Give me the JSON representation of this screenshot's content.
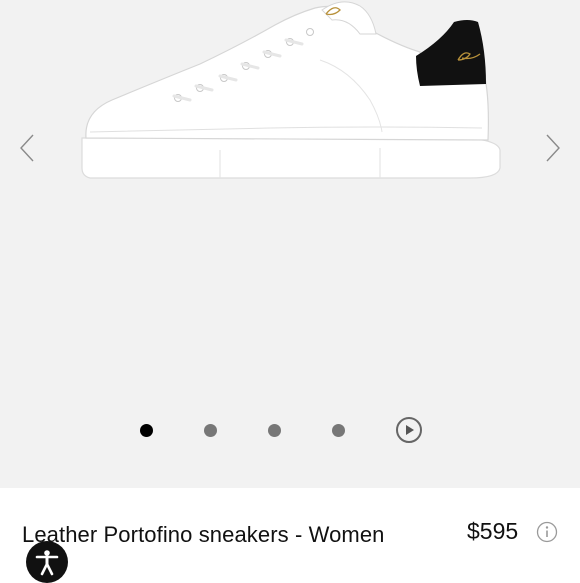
{
  "product": {
    "title": "Leather Portofino sneakers - Women",
    "price": "$595"
  },
  "gallery": {
    "image_alt": "white leather sneaker with black heel",
    "slide_count": 4,
    "active_slide": 1,
    "has_video": true
  },
  "icons": {
    "prev": "chevron-left-icon",
    "next": "chevron-right-icon",
    "video": "play-circle-icon",
    "info": "info-icon",
    "accessibility": "accessibility-icon"
  },
  "colors": {
    "gallery_bg": "#f2f2f2",
    "active_dot": "#000000",
    "inactive_dot": "#777777",
    "shoe_heel": "#111111",
    "logo_gold": "#b8913a"
  }
}
